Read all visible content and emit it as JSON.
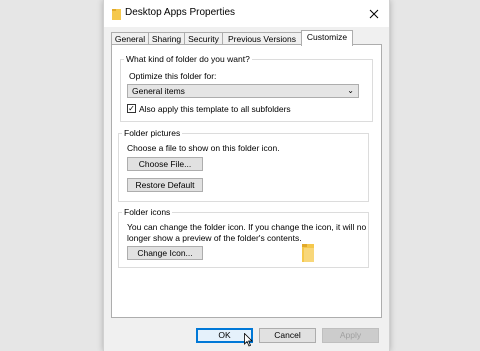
{
  "window": {
    "title": "Desktop Apps Properties"
  },
  "tabs": [
    {
      "label": "General"
    },
    {
      "label": "Sharing"
    },
    {
      "label": "Security"
    },
    {
      "label": "Previous Versions"
    },
    {
      "label": "Customize"
    }
  ],
  "active_tab": "Customize",
  "folder_type": {
    "heading": "What kind of folder do you want?",
    "optimize_label": "Optimize this folder for:",
    "selected_option": "General items",
    "checkbox_label": "Also apply this template to all subfolders",
    "checkbox_checked": true
  },
  "folder_pictures": {
    "heading": "Folder pictures",
    "description": "Choose a file to show on this folder icon.",
    "choose_button": "Choose File...",
    "restore_button": "Restore Default"
  },
  "folder_icons": {
    "heading": "Folder icons",
    "description_line1": "You can change the folder icon. If you change the icon, it will no",
    "description_line2": "longer show a preview of the folder's contents.",
    "change_button": "Change Icon..."
  },
  "footer": {
    "ok_label": "OK",
    "cancel_label": "Cancel",
    "apply_label": "Apply"
  },
  "icons": {
    "title": "folder-icon",
    "close": "close-icon",
    "preview": "folder-icon",
    "cursor": "mouse-pointer-icon"
  },
  "colors": {
    "accent": "#0078d7",
    "folder": "#f5c84c"
  }
}
